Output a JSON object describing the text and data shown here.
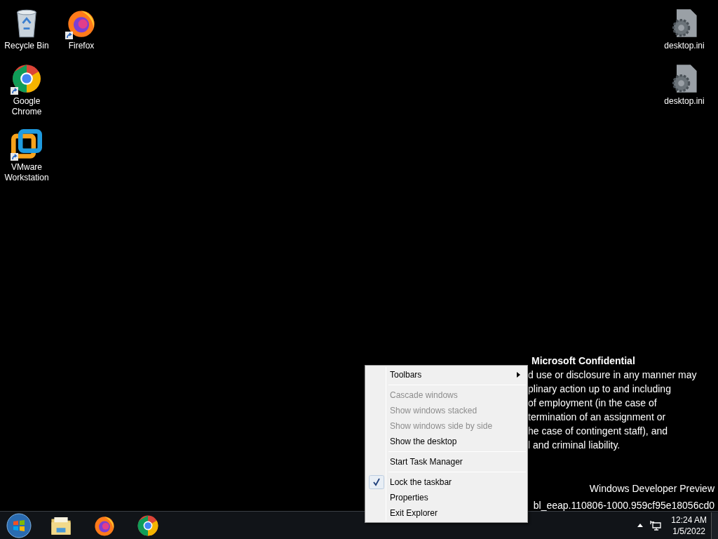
{
  "desktop": {
    "left_columns": [
      [
        {
          "label": "Recycle Bin",
          "kind": "bin",
          "shortcut": false
        },
        {
          "label": "Google Chrome",
          "kind": "chrome",
          "shortcut": true
        },
        {
          "label": "VMware Workstation",
          "kind": "vmware",
          "shortcut": true
        }
      ],
      [
        {
          "label": "Firefox",
          "kind": "firefox",
          "shortcut": true
        }
      ]
    ],
    "right_column": [
      {
        "label": "desktop.ini",
        "kind": "ini",
        "shortcut": false
      },
      {
        "label": "desktop.ini",
        "kind": "ini",
        "shortcut": false
      }
    ]
  },
  "watermark": {
    "title": "Microsoft Confidential",
    "lines": [
      "d use or disclosure in any manner may",
      "plinary action up to and including",
      "of employment (in the case of",
      "termination of an assignment or",
      "he case of contingent staff), and",
      "l and criminal liability."
    ],
    "edition": "Windows Developer Preview",
    "build": "bl_eeap.110806-1000.959cf95e18056cd0"
  },
  "context_menu": {
    "groups": [
      [
        {
          "label": "Toolbars",
          "disabled": false,
          "checked": false,
          "submenu": true
        }
      ],
      [
        {
          "label": "Cascade windows",
          "disabled": true,
          "checked": false,
          "submenu": false
        },
        {
          "label": "Show windows stacked",
          "disabled": true,
          "checked": false,
          "submenu": false
        },
        {
          "label": "Show windows side by side",
          "disabled": true,
          "checked": false,
          "submenu": false
        },
        {
          "label": "Show the desktop",
          "disabled": false,
          "checked": false,
          "submenu": false
        }
      ],
      [
        {
          "label": "Start Task Manager",
          "disabled": false,
          "checked": false,
          "submenu": false
        }
      ],
      [
        {
          "label": "Lock the taskbar",
          "disabled": false,
          "checked": true,
          "submenu": false
        },
        {
          "label": "Properties",
          "disabled": false,
          "checked": false,
          "submenu": false
        },
        {
          "label": "Exit Explorer",
          "disabled": false,
          "checked": false,
          "submenu": false
        }
      ]
    ]
  },
  "taskbar": {
    "pinned": [
      {
        "kind": "explorer"
      },
      {
        "kind": "firefox"
      },
      {
        "kind": "chrome"
      }
    ],
    "clock": {
      "time": "12:24 AM",
      "date": "1/5/2022"
    }
  }
}
